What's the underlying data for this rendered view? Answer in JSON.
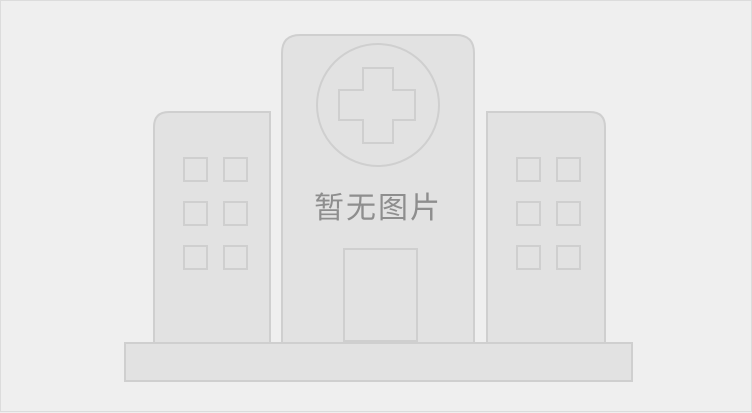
{
  "placeholder": {
    "text": "暂无图片",
    "icon": "hospital-building-icon"
  },
  "colors": {
    "background": "#efefef",
    "fill": "#e2e2e2",
    "stroke": "#cfcfcf",
    "text": "#8e8e8e"
  }
}
